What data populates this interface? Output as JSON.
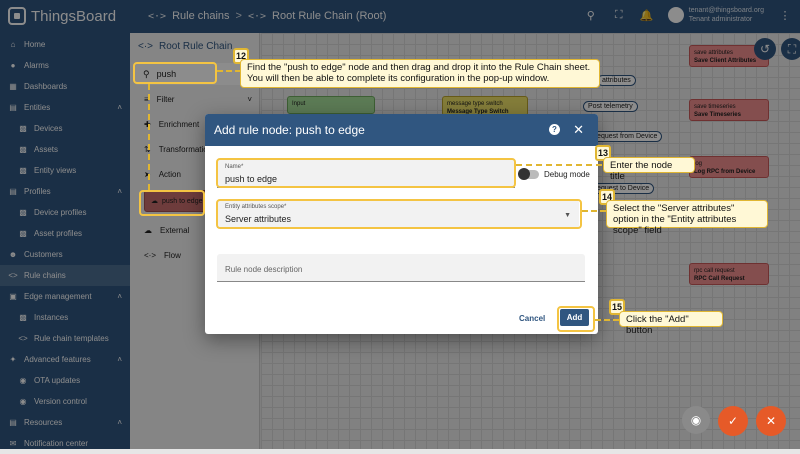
{
  "app": {
    "name": "ThingsBoard"
  },
  "breadcrumb": {
    "items": [
      "Rule chains",
      "Root Rule Chain (Root)"
    ],
    "separator": ">"
  },
  "user": {
    "email": "tenant@thingsboard.org",
    "role": "Tenant administrator"
  },
  "sidebar": {
    "items": [
      {
        "label": "Home",
        "icon": "home-icon"
      },
      {
        "label": "Alarms",
        "icon": "bell-icon"
      },
      {
        "label": "Dashboards",
        "icon": "dashboard-icon"
      },
      {
        "label": "Entities",
        "icon": "entities-icon",
        "expanded": true
      },
      {
        "label": "Devices",
        "icon": "device-icon",
        "sub": true
      },
      {
        "label": "Assets",
        "icon": "asset-icon",
        "sub": true
      },
      {
        "label": "Entity views",
        "icon": "view-icon",
        "sub": true
      },
      {
        "label": "Profiles",
        "icon": "profile-icon",
        "expanded": true
      },
      {
        "label": "Device profiles",
        "icon": "device-profile-icon",
        "sub": true
      },
      {
        "label": "Asset profiles",
        "icon": "asset-profile-icon",
        "sub": true
      },
      {
        "label": "Customers",
        "icon": "customers-icon"
      },
      {
        "label": "Rule chains",
        "icon": "rule-chain-icon",
        "active": true
      },
      {
        "label": "Edge management",
        "icon": "edge-icon",
        "expanded": true
      },
      {
        "label": "Instances",
        "icon": "instances-icon",
        "sub": true
      },
      {
        "label": "Rule chain templates",
        "icon": "template-icon",
        "sub": true
      },
      {
        "label": "Advanced features",
        "icon": "advanced-icon",
        "expanded": true
      },
      {
        "label": "OTA updates",
        "icon": "ota-icon",
        "sub": true
      },
      {
        "label": "Version control",
        "icon": "version-icon",
        "sub": true
      },
      {
        "label": "Resources",
        "icon": "resources-icon",
        "expanded": true
      },
      {
        "label": "Notification center",
        "icon": "notification-icon"
      }
    ]
  },
  "library": {
    "title": "Root Rule Chain",
    "search_value": "push",
    "categories": [
      "Filter",
      "Enrichment",
      "Transformation",
      "Action",
      "External",
      "Flow"
    ],
    "node_label": "push to edge"
  },
  "canvas": {
    "nodes": [
      {
        "type": "save attributes",
        "name": "Save Client Attributes",
        "color": "red"
      },
      {
        "type": "save timeseries",
        "name": "Save Timeseries",
        "color": "red"
      },
      {
        "type": "log",
        "name": "Log RPC from Device",
        "color": "red"
      },
      {
        "type": "rpc call request",
        "name": "RPC Call Request",
        "color": "red"
      },
      {
        "type": "message type switch",
        "name": "Message Type Switch",
        "color": "yellow"
      },
      {
        "type": "",
        "name": "Input",
        "color": "green"
      }
    ],
    "edge_labels": [
      "attributes",
      "Post telemetry",
      "Request from Device",
      "Request to Device"
    ]
  },
  "dialog": {
    "title": "Add rule node: push to edge",
    "name_label": "Name*",
    "name_value": "push to edge",
    "debug_label": "Debug mode",
    "scope_label": "Entity attributes scope*",
    "scope_value": "Server attributes",
    "description_placeholder": "Rule node description",
    "cancel_label": "Cancel",
    "add_label": "Add"
  },
  "callouts": {
    "c12": {
      "number": "12",
      "text": "Find the \"push to edge\" node and then drag and drop it into the Rule Chain sheet. You will then be able to complete its configuration in the pop-up window."
    },
    "c13": {
      "number": "13",
      "text": "Enter the node title"
    },
    "c14": {
      "number": "14",
      "text": "Select the \"Server attributes\" option in the \"Entity attributes scope\" field"
    },
    "c15": {
      "number": "15",
      "text": "Click the \"Add\" button"
    }
  },
  "colors": {
    "primary": "#305680",
    "callout_border": "#e0b632",
    "fab": "#e65a28"
  }
}
